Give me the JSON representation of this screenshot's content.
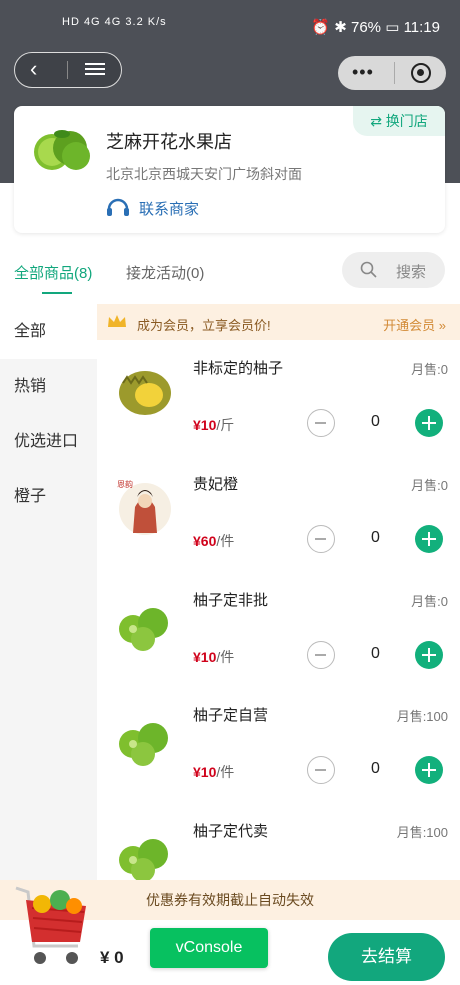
{
  "status_bar": {
    "network": "HD 4G 4G 3.2 K/s",
    "icons": [
      "sim-hd-icon",
      "signal-icon",
      "wifi-icon",
      "alarm-icon",
      "bluetooth-icon",
      "vibrate-icon",
      "battery-icon"
    ],
    "battery": "76%",
    "time": "11:19"
  },
  "store": {
    "name": "芝麻开花水果店",
    "address": "北京北京西城天安门广场斜对面",
    "contact_label": "联系商家",
    "switch_label": "⇄ 换门店"
  },
  "tabs": [
    {
      "label": "全部商品(8)",
      "active": true
    },
    {
      "label": "接龙活动(0)",
      "active": false
    }
  ],
  "search": {
    "label": "搜索"
  },
  "sidebar": {
    "items": [
      {
        "label": "全部",
        "active": true
      },
      {
        "label": "热销",
        "active": false
      },
      {
        "label": "优选进口",
        "active": false
      },
      {
        "label": "橙子",
        "active": false
      }
    ]
  },
  "member_bar": {
    "text": "成为会员，立享会员价!",
    "action": "开通会员 »"
  },
  "products": [
    {
      "title": "非标定的柚子",
      "sold": "月售:0",
      "price": "¥10",
      "unit": "/斤",
      "qty": "0",
      "image": "durian"
    },
    {
      "title": "贵妃橙",
      "sold": "月售:0",
      "price": "¥60",
      "unit": "/件",
      "qty": "0",
      "image": "portrait"
    },
    {
      "title": "柚子定非批",
      "sold": "月售:0",
      "price": "¥10",
      "unit": "/件",
      "qty": "0",
      "image": "limes"
    },
    {
      "title": "柚子定自营",
      "sold": "月售:100",
      "price": "¥10",
      "unit": "/件",
      "qty": "0",
      "image": "limes"
    },
    {
      "title": "柚子定代卖",
      "sold": "月售:100",
      "price": "",
      "unit": "",
      "qty": "",
      "image": "limes"
    }
  ],
  "coupon_notice": "优惠券有效期截止自动失效",
  "cart": {
    "total": "¥ 0"
  },
  "vconsole": {
    "label": "vConsole"
  },
  "checkout": {
    "label": "去结算"
  },
  "colors": {
    "accent": "#12a77d",
    "price_red": "#d0021b",
    "header_bg": "#4d5057",
    "member_bg": "#fdf0e1"
  }
}
